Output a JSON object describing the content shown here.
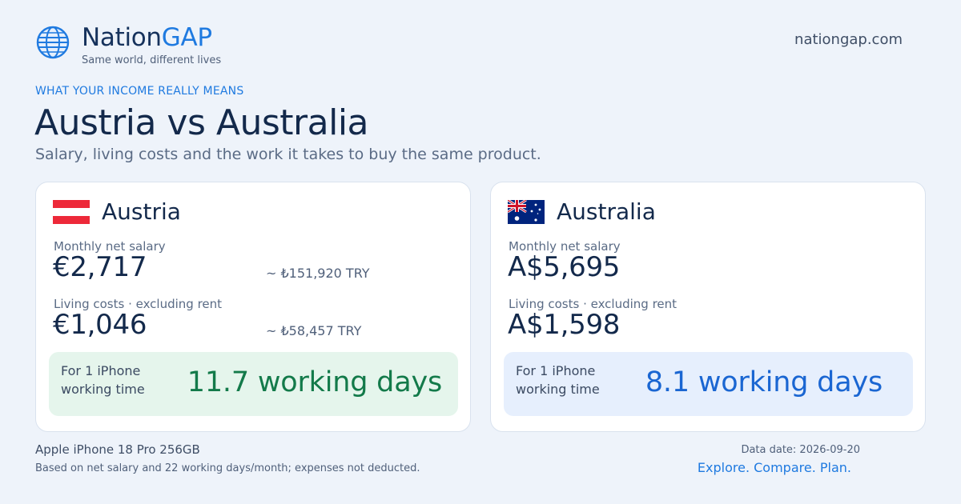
{
  "brand": {
    "name_part1": "Nation",
    "name_part2": "GAP",
    "tagline": "Same world, different lives",
    "site": "nationgap.com",
    "accent": "#1f7ae0"
  },
  "header": {
    "eyebrow": "WHAT YOUR INCOME REALLY MEANS",
    "title": "Austria vs Australia",
    "subtitle": "Salary, living costs and the work it takes to buy the same product."
  },
  "countries": [
    {
      "name": "Austria",
      "flag_icon": "austria-flag-icon",
      "salary_label": "Monthly net salary",
      "salary": "€2,717",
      "salary_conv": "~ ₺151,920 TRY",
      "costs_label": "Living costs · excluding rent",
      "costs": "€1,046",
      "costs_conv": "~ ₺58,457 TRY",
      "box_label": "For 1 iPhone working time",
      "box_value": "11.7 working days",
      "box_color": "#137a4a"
    },
    {
      "name": "Australia",
      "flag_icon": "australia-flag-icon",
      "salary_label": "Monthly net salary",
      "salary": "A$5,695",
      "costs_label": "Living costs · excluding rent",
      "costs": "A$1,598",
      "box_label": "For 1 iPhone working time",
      "box_value": "8.1 working days",
      "box_color": "#1a66d2"
    }
  ],
  "footer": {
    "product": "Apple iPhone 18 Pro 256GB",
    "note": "Based on net salary and 22 working days/month; expenses not deducted.",
    "date": "Data date: 2026-09-20",
    "cta": "Explore. Compare. Plan."
  }
}
